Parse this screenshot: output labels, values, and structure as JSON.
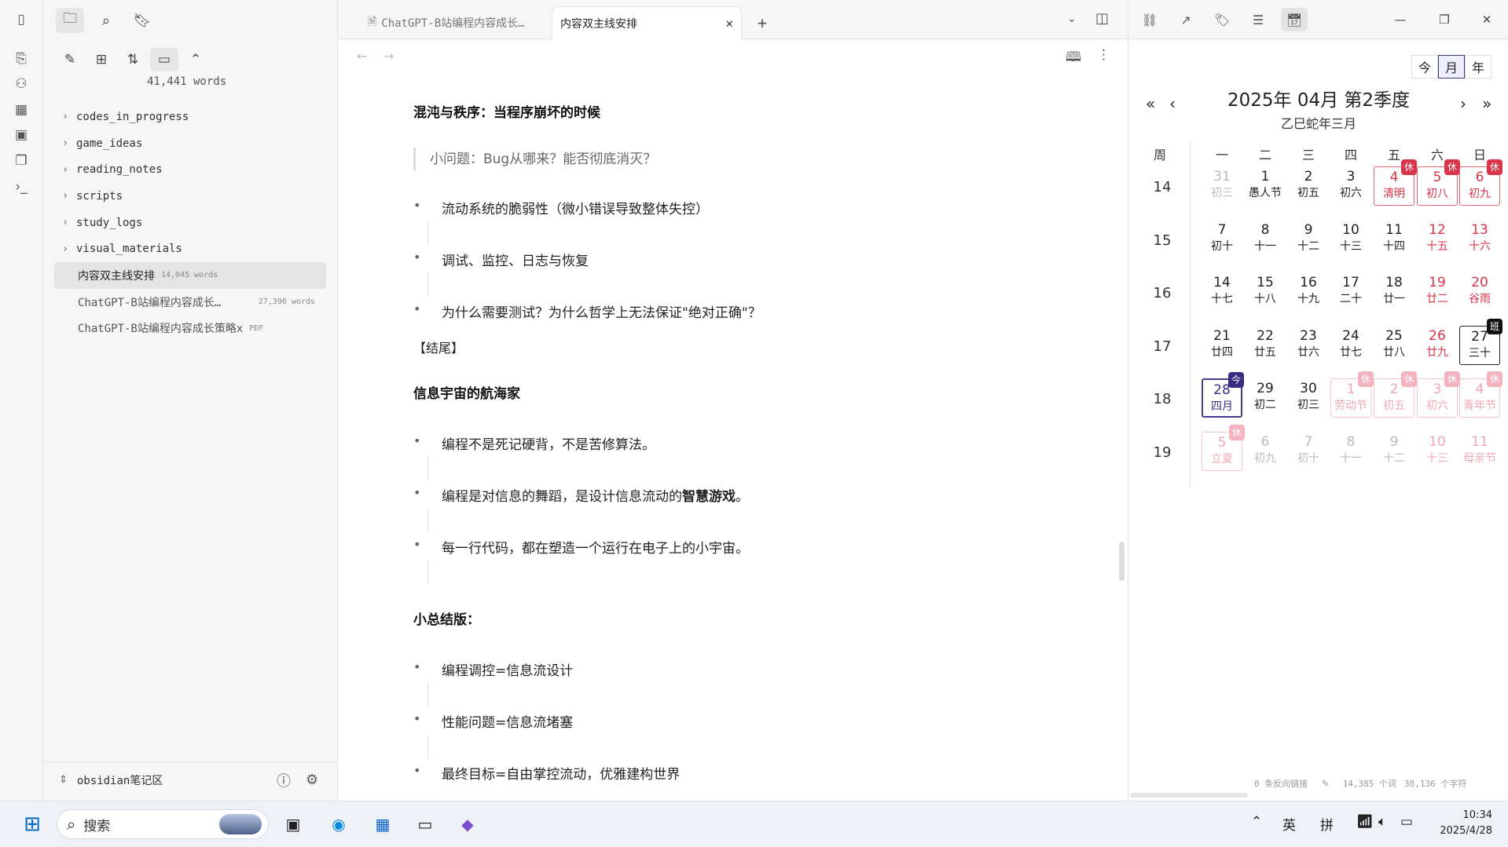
{
  "sidebar": {
    "word_count": "41,441 words",
    "folders": [
      "codes_in_progress",
      "game_ideas",
      "reading_notes",
      "scripts",
      "study_logs",
      "visual_materials"
    ],
    "files": [
      {
        "name": "内容双主线安排",
        "meta": "14,045 words",
        "active": true
      },
      {
        "name": "ChatGPT-B站编程内容成长…",
        "meta": "27,396 words",
        "active": false
      },
      {
        "name": "ChatGPT-B站编程内容成长策略x",
        "meta": "PDF",
        "active": false
      }
    ],
    "vault_name": "obsidian笔记区"
  },
  "tabs": [
    {
      "label": "ChatGPT-B站编程内容成长…",
      "active": false
    },
    {
      "label": "内容双主线安排",
      "active": true
    }
  ],
  "doc": {
    "h1": "混沌与秩序：当程序崩坏的时候",
    "quote": "小问题：Bug从哪来？能否彻底消灭？",
    "b1": [
      "流动系统的脆弱性（微小错误导致整体失控）",
      "调试、监控、日志与恢复",
      "为什么需要测试？为什么哲学上无法保证\"绝对正确\"？"
    ],
    "ending": "【结尾】",
    "h2": "信息宇宙的航海家",
    "b2a": "编程不是死记硬背，不是苦修算法。",
    "b2b_pre": "编程是对信息的舞蹈，是设计信息流动的",
    "b2b_bold": "智慧游戏",
    "b2b_post": "。",
    "b2c": "每一行代码，都在塑造一个运行在电子上的小宇宙。",
    "h3": "小总结版：",
    "b3": [
      "编程调控=信息流设计",
      "性能问题=信息流堵塞",
      "最终目标=自由掌控流动，优雅建构世界"
    ]
  },
  "calendar": {
    "view_buttons": [
      "今",
      "月",
      "年"
    ],
    "title": "2025年  04月  第2季度",
    "subtitle": "乙巳蛇年三月",
    "weekday_header": [
      "周",
      "一",
      "二",
      "三",
      "四",
      "五",
      "六",
      "日"
    ],
    "weeks": [
      {
        "wk": "14",
        "days": [
          {
            "n": "31",
            "l": "初三",
            "faded": true
          },
          {
            "n": "1",
            "l": "愚人节"
          },
          {
            "n": "2",
            "l": "初五"
          },
          {
            "n": "3",
            "l": "初六"
          },
          {
            "n": "4",
            "l": "清明",
            "red": true,
            "holiday": true,
            "badge": "休"
          },
          {
            "n": "5",
            "l": "初八",
            "red": true,
            "holiday": true,
            "badge": "休"
          },
          {
            "n": "6",
            "l": "初九",
            "red": true,
            "holiday": true,
            "badge": "休"
          }
        ]
      },
      {
        "wk": "15",
        "days": [
          {
            "n": "7",
            "l": "初十"
          },
          {
            "n": "8",
            "l": "十一"
          },
          {
            "n": "9",
            "l": "十二"
          },
          {
            "n": "10",
            "l": "十三"
          },
          {
            "n": "11",
            "l": "十四"
          },
          {
            "n": "12",
            "l": "十五",
            "red": true
          },
          {
            "n": "13",
            "l": "十六",
            "red": true
          }
        ]
      },
      {
        "wk": "16",
        "days": [
          {
            "n": "14",
            "l": "十七"
          },
          {
            "n": "15",
            "l": "十八"
          },
          {
            "n": "16",
            "l": "十九"
          },
          {
            "n": "17",
            "l": "二十"
          },
          {
            "n": "18",
            "l": "廿一"
          },
          {
            "n": "19",
            "l": "廿二",
            "red": true
          },
          {
            "n": "20",
            "l": "谷雨",
            "red": true
          }
        ]
      },
      {
        "wk": "17",
        "days": [
          {
            "n": "21",
            "l": "廿四"
          },
          {
            "n": "22",
            "l": "廿五"
          },
          {
            "n": "23",
            "l": "廿六"
          },
          {
            "n": "24",
            "l": "廿七"
          },
          {
            "n": "25",
            "l": "廿八"
          },
          {
            "n": "26",
            "l": "廿九",
            "red": true
          },
          {
            "n": "27",
            "l": "三十",
            "work": true,
            "badge": "班"
          }
        ]
      },
      {
        "wk": "18",
        "days": [
          {
            "n": "28",
            "l": "四月",
            "today": true,
            "badge": "今"
          },
          {
            "n": "29",
            "l": "初二"
          },
          {
            "n": "30",
            "l": "初三"
          },
          {
            "n": "1",
            "l": "劳动节",
            "faded": true,
            "red": true,
            "holiday": true,
            "badge": "休"
          },
          {
            "n": "2",
            "l": "初五",
            "faded": true,
            "red": true,
            "holiday": true,
            "badge": "休"
          },
          {
            "n": "3",
            "l": "初六",
            "faded": true,
            "red": true,
            "holiday": true,
            "badge": "休"
          },
          {
            "n": "4",
            "l": "青年节",
            "faded": true,
            "red": true,
            "holiday": true,
            "badge": "休"
          }
        ]
      },
      {
        "wk": "19",
        "days": [
          {
            "n": "5",
            "l": "立夏",
            "faded": true,
            "red": true,
            "holiday": true,
            "badge": "休"
          },
          {
            "n": "6",
            "l": "初九",
            "faded": true
          },
          {
            "n": "7",
            "l": "初十",
            "faded": true
          },
          {
            "n": "8",
            "l": "十一",
            "faded": true
          },
          {
            "n": "9",
            "l": "十二",
            "faded": true
          },
          {
            "n": "10",
            "l": "十三",
            "faded": true,
            "red": true
          },
          {
            "n": "11",
            "l": "母亲节",
            "faded": true,
            "red": true
          }
        ]
      }
    ]
  },
  "status": {
    "backlinks": "0 条反向链接",
    "words": "14,385 个词",
    "chars": "30,136 个字符"
  },
  "taskbar": {
    "search": "搜索",
    "ime1": "英",
    "ime2": "拼",
    "time": "10:34",
    "date": "2025/4/28"
  },
  "colors": {
    "accent_red": "#d9344a",
    "today": "#3a2c80"
  }
}
